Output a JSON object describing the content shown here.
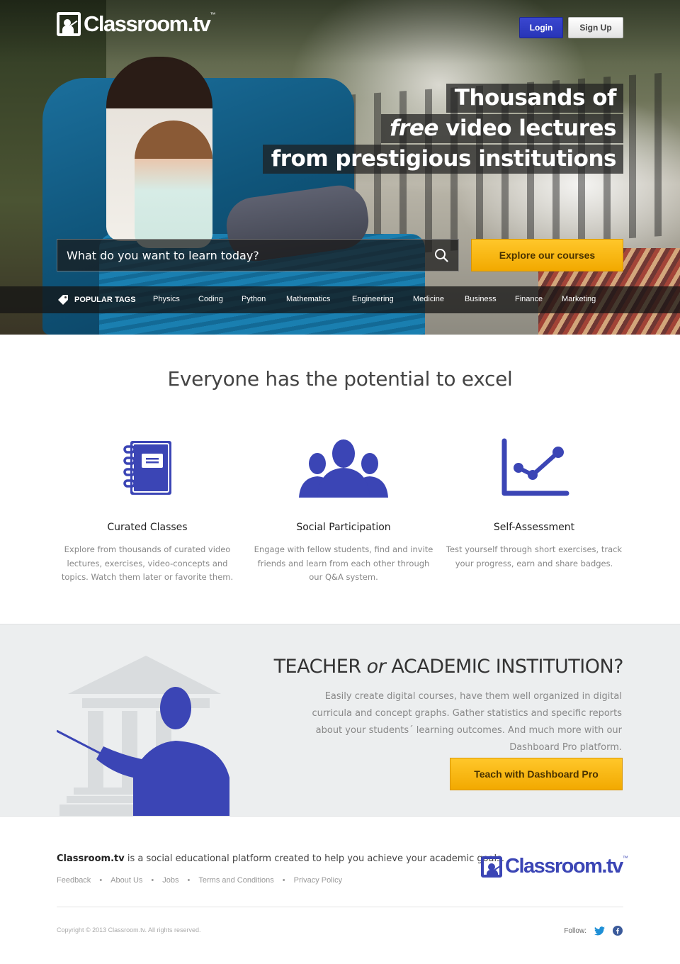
{
  "brand": {
    "name": "Classroom.tv",
    "name_main": "Classroom.tv",
    "tm": "™",
    "accent": "#3b45b5",
    "cta": "#f5b400"
  },
  "header": {
    "login_label": "Login",
    "signup_label": "Sign Up"
  },
  "hero": {
    "headline_1": "Thousands of",
    "headline_2_em": "free",
    "headline_2_rest": " video lectures",
    "headline_3": "from prestigious institutions"
  },
  "search": {
    "placeholder": "What do you want to learn today?",
    "icon": "search-icon"
  },
  "explore_label": "Explore our courses",
  "tags": {
    "label": "POPULAR TAGS",
    "items": [
      "Physics",
      "Coding",
      "Python",
      "Mathematics",
      "Engineering",
      "Medicine",
      "Business",
      "Finance",
      "Marketing"
    ]
  },
  "features": {
    "title": "Everyone has the potential to excel",
    "items": [
      {
        "title": "Curated Classes",
        "text": "Explore from thousands of curated video lectures, exercises, video-concepts and topics. Watch them later or favorite them.",
        "icon": "notebook-icon"
      },
      {
        "title": "Social Participation",
        "text": "Engage with fellow students, find and invite friends and learn from each other through our Q&A system.",
        "icon": "people-icon"
      },
      {
        "title": "Self-Assessment",
        "text": "Test yourself through short exercises, track your progress, earn and share badges.",
        "icon": "chart-icon"
      }
    ]
  },
  "teacher": {
    "title_a": "TEACHER ",
    "title_or": "or",
    "title_b": " ACADEMIC INSTITUTION?",
    "text": "Easily create digital courses, have them well organized in digital curricula and concept graphs. Gather statistics and specific reports about your students´ learning outcomes. And much more with our Dashboard Pro platform.",
    "button": "Teach with Dashboard Pro"
  },
  "footer": {
    "about_brand": "Classroom.tv",
    "about_rest": " is a social educational platform created to help you achieve your academic goals.",
    "links": [
      "Feedback",
      "About Us",
      "Jobs",
      "Terms and Conditions",
      "Privacy Policy"
    ],
    "copyright": "Copyright © 2013 Classroom.tv. All rights reserved.",
    "follow_label": "Follow:"
  }
}
